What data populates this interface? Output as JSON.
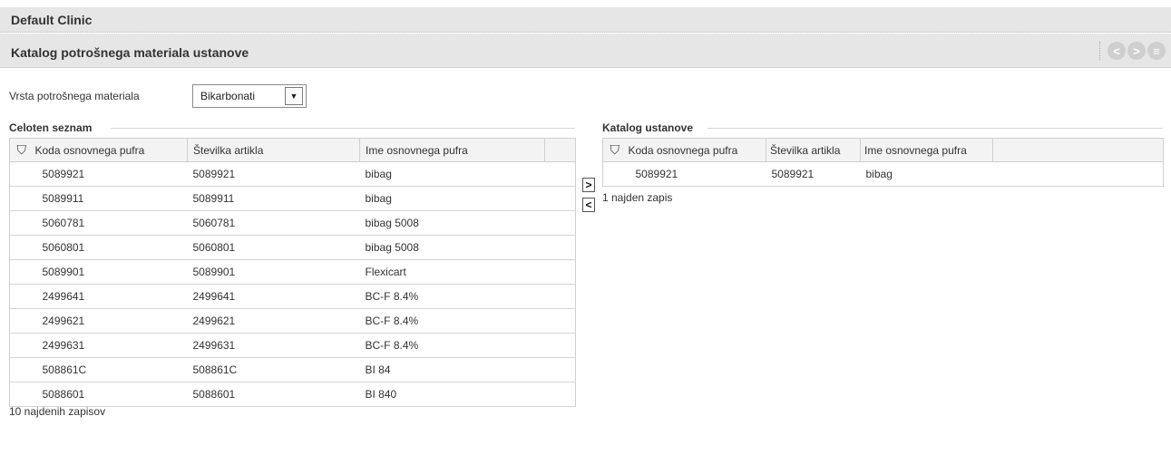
{
  "header": {
    "clinic_title": "Default Clinic"
  },
  "subheader": {
    "title": "Katalog potrošnega materiala ustanove",
    "nav": {
      "prev_icon": "<",
      "next_icon": ">",
      "menu_icon": "≡"
    }
  },
  "filter": {
    "label": "Vrsta potrošnega materiala",
    "selected": "Bikarbonati"
  },
  "left": {
    "title": "Celoten seznam",
    "columns": [
      "Koda osnovnega pufra",
      "Številka artikla",
      "Ime osnovnega pufra"
    ],
    "rows": [
      [
        "5089921",
        "5089921",
        "bibag"
      ],
      [
        "5089911",
        "5089911",
        "bibag"
      ],
      [
        "5060781",
        "5060781",
        "bibag 5008"
      ],
      [
        "5060801",
        "5060801",
        "bibag 5008"
      ],
      [
        "5089901",
        "5089901",
        "Flexicart"
      ],
      [
        "2499641",
        "2499641",
        "BC-F 8.4%"
      ],
      [
        "2499621",
        "2499621",
        "BC-F 8.4%"
      ],
      [
        "2499631",
        "2499631",
        "BC-F 8.4%"
      ],
      [
        "508861C",
        "508861C",
        "BI 84"
      ],
      [
        "5088601",
        "5088601",
        "BI 840"
      ]
    ],
    "count_text": "10 najdenih zapisov"
  },
  "right": {
    "title": "Katalog ustanove",
    "columns": [
      "Koda osnovnega pufra",
      "Številka artikla",
      "Ime osnovnega pufra"
    ],
    "rows": [
      [
        "5089921",
        "5089921",
        "bibag"
      ]
    ],
    "count_text": "1 najden zapis"
  },
  "transfer": {
    "add_label": ">",
    "remove_label": "<"
  }
}
